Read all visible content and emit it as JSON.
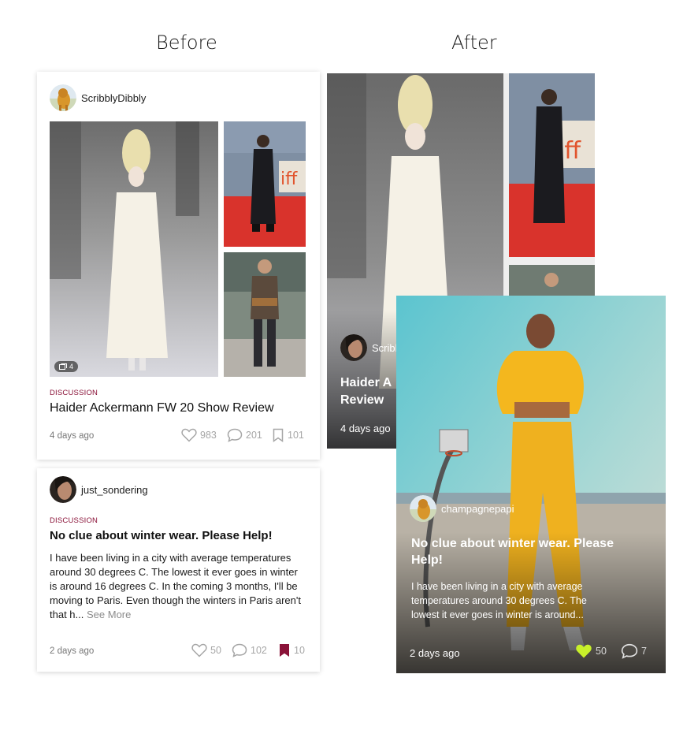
{
  "headings": {
    "before": "Before",
    "after": "After"
  },
  "before": {
    "card1": {
      "username": "ScribblyDibbly",
      "tag": "DISCUSSION",
      "title": "Haider Ackermann FW 20 Show Review",
      "date": "4 days ago",
      "image_count": "4",
      "likes": "983",
      "comments": "201",
      "saves": "101"
    },
    "card2": {
      "username": "just_sondering",
      "tag": "DISCUSSION",
      "title": "No clue about winter wear. Please Help!",
      "body": "I have been living in a city with average temperatures around 30 degrees C. The lowest it ever goes in winter is around 16 degrees C. In the coming 3 months, I'll be moving to Paris. Even though the winters in Paris aren't that h...",
      "see_more": "See More",
      "date": "2 days ago",
      "likes": "50",
      "comments": "102",
      "saves": "10"
    }
  },
  "after": {
    "card1": {
      "username": "Scribb",
      "title_line1": "Haider A",
      "title_line2": "Review",
      "date": "4 days ago"
    },
    "card2": {
      "username": "champagnepapi",
      "title": "No clue about winter wear. Please Help!",
      "body": "I have been living in a city with average temperatures around 30 degrees C. The lowest it ever goes in winter is around...",
      "date": "2 days ago",
      "likes": "50",
      "comments": "7"
    }
  },
  "colors": {
    "accent_maroon": "#8a1238",
    "like_highlight": "#c8f02a",
    "muted_gray": "#a6a6a6"
  },
  "icons": [
    "heart-icon",
    "comment-icon",
    "bookmark-icon",
    "images-icon"
  ]
}
